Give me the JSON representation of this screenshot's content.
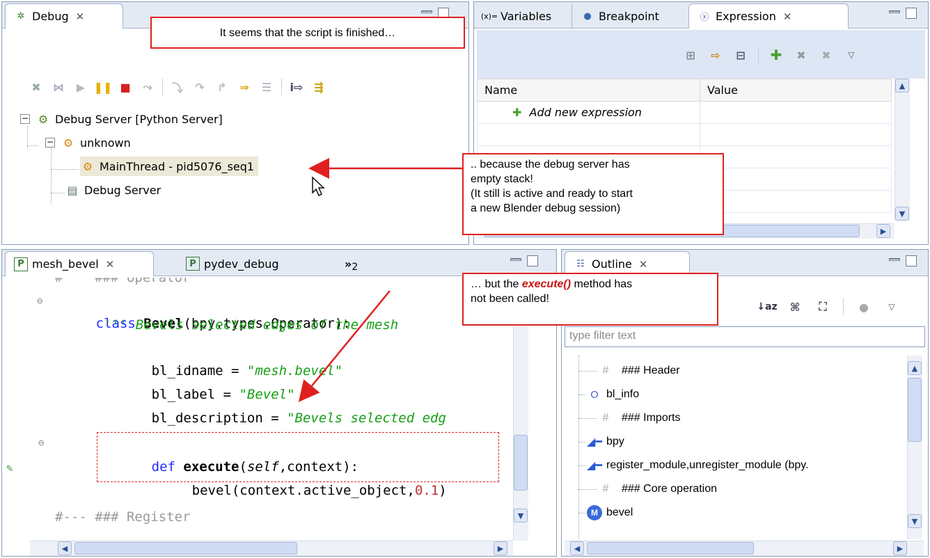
{
  "debug_view": {
    "tab_label": "Debug",
    "toolbar_icons": [
      "remove-all-terminated-icon",
      "disconnect-icon",
      "resume-icon",
      "suspend-icon",
      "terminate-icon",
      "drop-to-frame-icon",
      "step-into-icon",
      "step-over-icon",
      "step-return-icon",
      "run-to-line-icon",
      "step-filters-icon",
      "instruction-step-icon",
      "use-step-filters-icon"
    ],
    "tree": [
      {
        "label": "Debug Server [Python Server]"
      },
      {
        "label": "unknown"
      },
      {
        "label": "MainThread - pid5076_seq1"
      },
      {
        "label": "Debug Server"
      }
    ]
  },
  "expressions_view": {
    "tabs": [
      {
        "label": "Variables"
      },
      {
        "label": "Breakpoint"
      },
      {
        "label": "Expression"
      }
    ],
    "columns": [
      "Name",
      "Value"
    ],
    "add_new_label": "Add new expression"
  },
  "editor": {
    "tabs": [
      {
        "label": "mesh_bevel"
      },
      {
        "label": "pydev_debug"
      }
    ],
    "overflow_count": "2",
    "code": {
      "l0": "#    ### Operator",
      "l1_kw": "class",
      "l1_name": "Bevel",
      "l1_rest": "(bpy.types.Operator):",
      "l2": "''' Bevels selected edges of the mesh",
      "l3_a": "bl_idname = ",
      "l3_b": "\"mesh.bevel\"",
      "l4_a": "bl_label = ",
      "l4_b": "\"Bevel\"",
      "l5_a": "bl_description = ",
      "l5_b": "\"Bevels selected edg",
      "l7_kw": "def",
      "l7_name": "execute",
      "l7_self": "self",
      "l7_rest": ",context):",
      "l8_a": "bevel(context.active_object,",
      "l8_num": "0.1",
      "l8_b": ")",
      "l10": "#--- ### Register"
    }
  },
  "outline_view": {
    "tab_label": "Outline",
    "filter_placeholder": "type filter text",
    "items": [
      {
        "label": "### Header",
        "icon": "comment-icon"
      },
      {
        "label": "bl_info",
        "icon": "attribute-icon"
      },
      {
        "label": "### Imports",
        "icon": "comment-icon"
      },
      {
        "label": "bpy",
        "icon": "import-icon"
      },
      {
        "label": "register_module,unregister_module (bpy.",
        "icon": "import-icon"
      },
      {
        "label": "### Core operation",
        "icon": "comment-icon"
      },
      {
        "label": "bevel",
        "icon": "method-icon"
      }
    ]
  },
  "callouts": {
    "finished": "It seems that the script is finished…",
    "empty_stack": [
      ".. because the debug server has",
      "empty stack!",
      "(It still is active and ready to start",
      "a new Blender debug session)"
    ],
    "execute_a": "… but the ",
    "execute_b": "execute()",
    "execute_c": " method has",
    "execute_d": "not been called!"
  },
  "colors": {
    "callout_border": "#e02020",
    "keyword": "#2030ff",
    "string": "#16a016",
    "number": "#c03030"
  }
}
